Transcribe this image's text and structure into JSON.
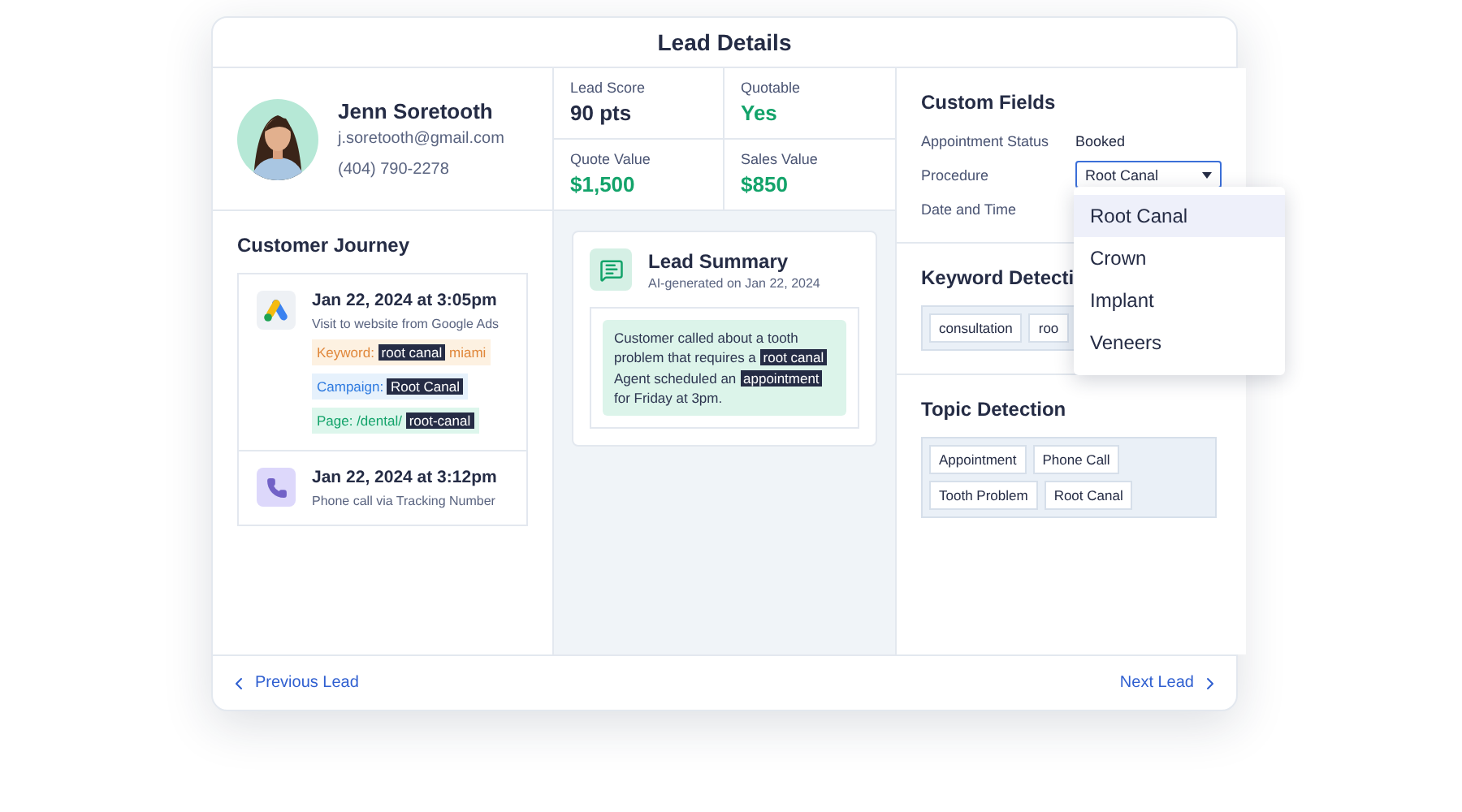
{
  "title": "Lead Details",
  "contact": {
    "name": "Jenn Soretooth",
    "email": "j.soretooth@gmail.com",
    "phone": "(404) 790-2278"
  },
  "journey": {
    "title": "Customer Journey",
    "events": [
      {
        "kind": "ads",
        "time": "Jan 22, 2024 at 3:05pm",
        "description": "Visit to website from Google Ads",
        "tags": [
          {
            "kind": "keyword",
            "parts": [
              {
                "text": "Keyword: ",
                "highlight": false
              },
              {
                "text": "root canal",
                "highlight": true
              },
              {
                "text": " miami",
                "highlight": false
              }
            ]
          },
          {
            "kind": "campaign",
            "parts": [
              {
                "text": "Campaign: ",
                "highlight": false
              },
              {
                "text": "Root Canal",
                "highlight": true
              }
            ]
          },
          {
            "kind": "page",
            "parts": [
              {
                "text": "Page: /dental/ ",
                "highlight": false
              },
              {
                "text": "root-canal",
                "highlight": true
              }
            ]
          }
        ]
      },
      {
        "kind": "call",
        "time": "Jan 22, 2024 at 3:12pm",
        "description": "Phone call via Tracking Number"
      }
    ]
  },
  "stats": [
    {
      "label": "Lead Score",
      "value": "90 pts",
      "kind": "plain"
    },
    {
      "label": "Quotable",
      "value": "Yes",
      "kind": "positive"
    },
    {
      "label": "Quote Value",
      "value": "$1,500",
      "kind": "positive"
    },
    {
      "label": "Sales Value",
      "value": "$850",
      "kind": "positive"
    }
  ],
  "summary": {
    "title": "Lead Summary",
    "subtitle": "AI-generated on Jan 22, 2024",
    "parts": [
      {
        "text": "Customer called about a tooth problem that requires a ",
        "highlight": false
      },
      {
        "text": "root canal",
        "highlight": true
      },
      {
        "text": " Agent scheduled an ",
        "highlight": false
      },
      {
        "text": "appointment",
        "highlight": true
      },
      {
        "text": " for Friday at 3pm.",
        "highlight": false
      }
    ]
  },
  "custom_fields": {
    "title": "Custom Fields",
    "fields": [
      {
        "label": "Appointment Status",
        "kind": "text",
        "value": "Booked"
      },
      {
        "label": "Procedure",
        "kind": "select",
        "value": "Root Canal"
      },
      {
        "label": "Date and Time",
        "kind": "text"
      }
    ],
    "dropdown": [
      {
        "label": "Root Canal",
        "selected": true
      },
      {
        "label": "Crown",
        "selected": false
      },
      {
        "label": "Implant",
        "selected": false
      },
      {
        "label": "Veneers",
        "selected": false
      }
    ]
  },
  "keyword_detection": {
    "title": "Keyword Detecti",
    "tags": [
      "consultation",
      "roo"
    ]
  },
  "topic_detection": {
    "title": "Topic Detection",
    "tags": [
      "Appointment",
      "Phone Call",
      "Tooth Problem",
      "Root Canal"
    ]
  },
  "footer": {
    "previous": "Previous Lead",
    "next": "Next Lead"
  }
}
